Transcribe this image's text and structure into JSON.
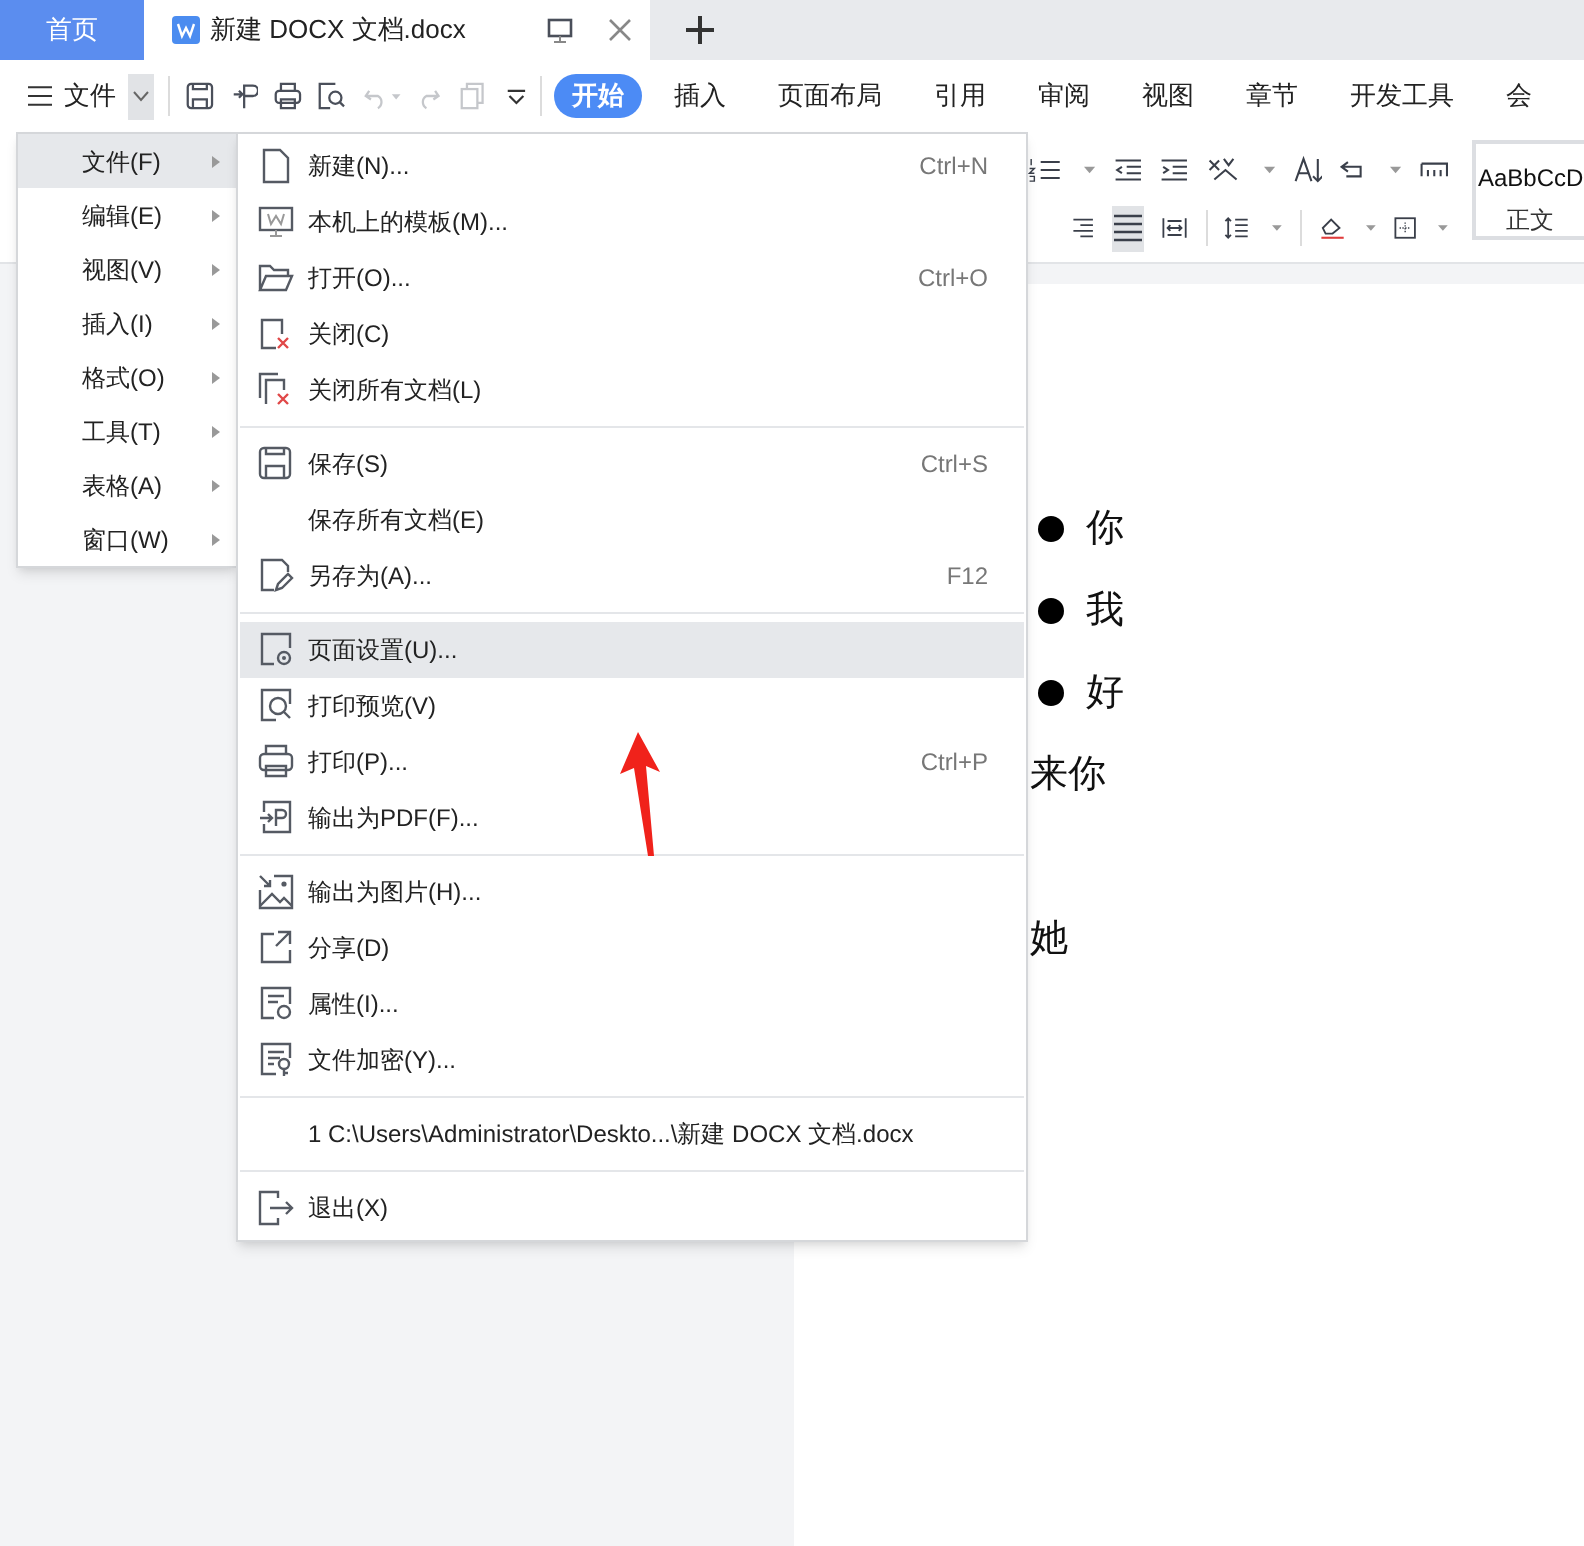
{
  "tabs": [
    {
      "label": "首页",
      "kind": "home",
      "selected": false
    },
    {
      "label": "新建 DOCX 文档.docx",
      "kind": "doc",
      "selected": true
    }
  ],
  "menu_button": {
    "label": "文件"
  },
  "ribbon_tabs": [
    {
      "label": "开始",
      "selected": true
    },
    {
      "label": "插入",
      "selected": false
    },
    {
      "label": "页面布局",
      "selected": false
    },
    {
      "label": "引用",
      "selected": false
    },
    {
      "label": "审阅",
      "selected": false
    },
    {
      "label": "视图",
      "selected": false
    },
    {
      "label": "章节",
      "selected": false
    },
    {
      "label": "开发工具",
      "selected": false
    },
    {
      "label": "会",
      "selected": false
    }
  ],
  "style_gallery": {
    "preview": "AaBbCcD",
    "name": "正文"
  },
  "menu": [
    {
      "label": "文件(F)",
      "selected": true
    },
    {
      "label": "编辑(E)",
      "selected": false
    },
    {
      "label": "视图(V)",
      "selected": false
    },
    {
      "label": "插入(I)",
      "selected": false
    },
    {
      "label": "格式(O)",
      "selected": false
    },
    {
      "label": "工具(T)",
      "selected": false
    },
    {
      "label": "表格(A)",
      "selected": false
    },
    {
      "label": "窗口(W)",
      "selected": false
    }
  ],
  "submenu_groups": [
    {
      "items": [
        {
          "label": "新建(N)...",
          "shortcut": "Ctrl+N",
          "selected": false
        },
        {
          "label": "本机上的模板(M)...",
          "selected": false
        },
        {
          "label": "打开(O)...",
          "shortcut": "Ctrl+O",
          "selected": false
        },
        {
          "label": "关闭(C)",
          "selected": false
        },
        {
          "label": "关闭所有文档(L)",
          "selected": false
        }
      ]
    },
    {
      "items": [
        {
          "label": "保存(S)",
          "shortcut": "Ctrl+S",
          "selected": false
        },
        {
          "label": "保存所有文档(E)",
          "selected": false
        },
        {
          "label": "另存为(A)...",
          "shortcut": "F12",
          "selected": false
        }
      ]
    },
    {
      "items": [
        {
          "label": "页面设置(U)...",
          "selected": true
        },
        {
          "label": "打印预览(V)",
          "selected": false
        },
        {
          "label": "打印(P)...",
          "shortcut": "Ctrl+P",
          "selected": false
        },
        {
          "label": "输出为PDF(F)...",
          "selected": false
        }
      ]
    },
    {
      "items": [
        {
          "label": "输出为图片(H)...",
          "selected": false
        },
        {
          "label": "分享(D)",
          "selected": false
        },
        {
          "label": "属性(I)...",
          "selected": false
        },
        {
          "label": "文件加密(Y)...",
          "selected": false
        }
      ]
    },
    {
      "items": [
        {
          "label": "1 C:\\Users\\Administrator\\Deskto...\\新建 DOCX 文档.docx",
          "selected": false
        }
      ]
    },
    {
      "items": [
        {
          "label": "退出(X)",
          "selected": false
        }
      ]
    }
  ],
  "document": {
    "paragraphs": [
      {
        "kind": "bullet",
        "text": "你"
      },
      {
        "kind": "bullet",
        "text": "我"
      },
      {
        "kind": "bullet",
        "text": "好"
      },
      {
        "kind": "plain",
        "text": "来你"
      },
      {
        "kind": "blank"
      },
      {
        "kind": "plain",
        "text": "她"
      }
    ]
  }
}
